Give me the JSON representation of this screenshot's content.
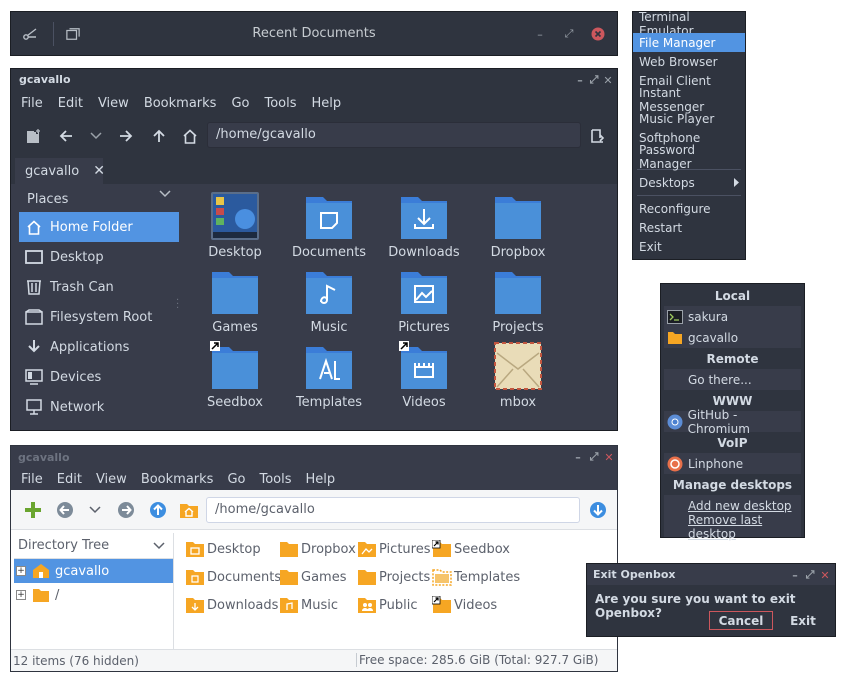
{
  "recent_bar": {
    "title": "Recent Documents"
  },
  "fm_dark": {
    "title": "gcavallo",
    "menu": [
      "File",
      "Edit",
      "View",
      "Bookmarks",
      "Go",
      "Tools",
      "Help"
    ],
    "address": "/home/gcavallo",
    "tab": "gcavallo",
    "places_header": "Places",
    "places": [
      "Home Folder",
      "Desktop",
      "Trash Can",
      "Filesystem Root",
      "Applications",
      "Devices",
      "Network"
    ],
    "files": [
      "Desktop",
      "Documents",
      "Downloads",
      "Dropbox",
      "Games",
      "Music",
      "Pictures",
      "Projects",
      "Seedbox",
      "Templates",
      "Videos",
      "mbox"
    ]
  },
  "fm_light": {
    "title": "gcavallo",
    "menu": [
      "File",
      "Edit",
      "View",
      "Bookmarks",
      "Go",
      "Tools",
      "Help"
    ],
    "address": "/home/gcavallo",
    "tree_header": "Directory Tree",
    "tree": [
      "gcavallo",
      "/"
    ],
    "files": [
      "Desktop",
      "Dropbox",
      "Pictures",
      "Seedbox",
      "Documents",
      "Games",
      "Projects",
      "Templates",
      "Downloads",
      "Music",
      "Public",
      "Videos"
    ],
    "status_left": "12 items (76 hidden)",
    "status_right": "Free space: 285.6 GiB (Total: 927.7 GiB)"
  },
  "root_menu": {
    "items": [
      "Terminal Emulator",
      "File Manager",
      "Web Browser",
      "Email Client",
      "Instant Messenger",
      "Music Player",
      "Softphone",
      "Password Manager"
    ],
    "desktops": "Desktops",
    "items2": [
      "Reconfigure",
      "Restart",
      "Exit"
    ]
  },
  "places_menu": {
    "local_header": "Local",
    "local": [
      "sakura",
      "gcavallo"
    ],
    "remote_header": "Remote",
    "remote": "Go there...",
    "www_header": "WWW",
    "www": "GitHub - Chromium",
    "voip_header": "VoIP",
    "voip": "Linphone",
    "manage_header": "Manage desktops",
    "manage": [
      "Add new desktop",
      "Remove last desktop"
    ]
  },
  "exit_dialog": {
    "title": "Exit Openbox",
    "message": "Are you sure you want to exit Openbox?",
    "cancel": "Cancel",
    "exit": "Exit"
  },
  "colors": {
    "accent": "#5294e2",
    "folder_blue": "#4a90d9",
    "folder_orange": "#f6a623",
    "close_red": "#cc575d"
  }
}
